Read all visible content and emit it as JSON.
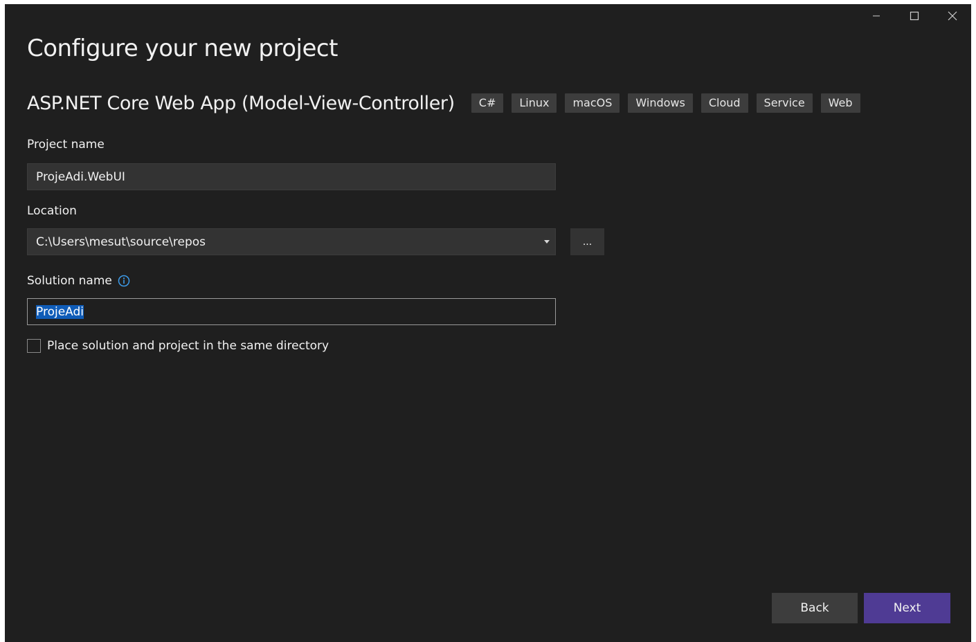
{
  "title": "Configure your new project",
  "template": {
    "name": "ASP.NET Core Web App (Model-View-Controller)",
    "tags": [
      "C#",
      "Linux",
      "macOS",
      "Windows",
      "Cloud",
      "Service",
      "Web"
    ]
  },
  "project_name": {
    "label": "Project name",
    "value": "ProjeAdi.WebUI"
  },
  "location": {
    "label": "Location",
    "value": "C:\\Users\\mesut\\source\\repos",
    "browse_label": "..."
  },
  "solution_name": {
    "label": "Solution name",
    "value": "ProjeAdi"
  },
  "same_directory": {
    "label": "Place solution and project in the same directory",
    "checked": false
  },
  "buttons": {
    "back": "Back",
    "next": "Next"
  },
  "colors": {
    "background": "#1f1f1f",
    "field": "#333333",
    "tag": "#3d3d3d",
    "primary": "#4f3b94",
    "selection": "#0f5cb8",
    "info_icon": "#3d9be9"
  },
  "icons": {
    "minimize": "minimize-icon",
    "maximize": "maximize-icon",
    "close": "close-icon",
    "dropdown": "caret-down-icon",
    "info": "info-icon"
  }
}
